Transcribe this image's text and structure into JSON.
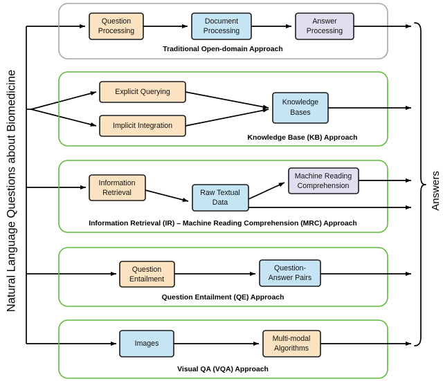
{
  "figure": {
    "left_axis_label": "Natural Language Questions about Biomedicine",
    "right_axis_label": "Answers"
  },
  "colors": {
    "orange_fill": "#fbe2c0",
    "blue_fill": "#c5e5f5",
    "purple_fill": "#dfdff0",
    "box_stroke": "#1a1a1a",
    "panel_green": "#5cbb3b",
    "panel_gray": "#a6a6a6",
    "line_black": "#000000",
    "text_black": "#111111"
  },
  "panels": [
    {
      "id": "traditional",
      "caption": "Traditional Open-domain Approach",
      "border_color": "#a6a6a6",
      "boxes": [
        {
          "id": "question-processing",
          "line1": "Question",
          "line2": "Processing",
          "fill": "orange"
        },
        {
          "id": "document-processing",
          "line1": "Document",
          "line2": "Processing",
          "fill": "blue"
        },
        {
          "id": "answer-processing",
          "line1": "Answer",
          "line2": "Processing",
          "fill": "purple"
        }
      ]
    },
    {
      "id": "knowledge-base",
      "caption": "Knowledge Base (KB) Approach",
      "border_color": "#5cbb3b",
      "boxes": [
        {
          "id": "explicit-querying",
          "line1": "Explicit Querying",
          "line2": "",
          "fill": "orange"
        },
        {
          "id": "implicit-integration",
          "line1": "Implicit Integration",
          "line2": "",
          "fill": "orange"
        },
        {
          "id": "knowledge-bases",
          "line1": "Knowledge",
          "line2": "Bases",
          "fill": "blue"
        }
      ]
    },
    {
      "id": "ir-mrc",
      "caption": "Information Retrieval (IR) – Machine Reading Comprehension (MRC) Approach",
      "border_color": "#5cbb3b",
      "boxes": [
        {
          "id": "information-retrieval",
          "line1": "Information",
          "line2": "Retrieval",
          "fill": "orange"
        },
        {
          "id": "raw-textual-data",
          "line1": "Raw Textual",
          "line2": "Data",
          "fill": "blue"
        },
        {
          "id": "machine-reading-comprehension",
          "line1": "Machine Reading",
          "line2": "Comprehension",
          "fill": "purple"
        }
      ]
    },
    {
      "id": "question-entailment",
      "caption": "Question Entailment (QE) Approach",
      "border_color": "#5cbb3b",
      "boxes": [
        {
          "id": "question-entailment",
          "line1": "Question",
          "line2": "Entailment",
          "fill": "orange"
        },
        {
          "id": "question-answer-pairs",
          "line1": "Question-",
          "line2": "Answer Pairs",
          "fill": "blue"
        }
      ]
    },
    {
      "id": "visual-qa",
      "caption": "Visual QA (VQA) Approach",
      "border_color": "#5cbb3b",
      "boxes": [
        {
          "id": "images",
          "line1": "Images",
          "line2": "",
          "fill": "blue"
        },
        {
          "id": "multi-modal-algorithms",
          "line1": "Multi-modal",
          "line2": "Algorithms",
          "fill": "orange"
        }
      ]
    }
  ]
}
